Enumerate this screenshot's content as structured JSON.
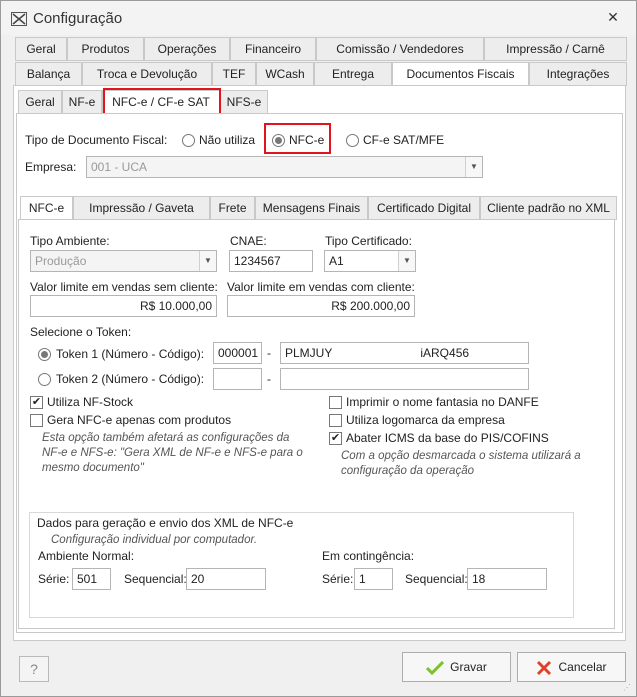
{
  "window": {
    "title": "Configuração"
  },
  "tabs_row1": [
    "Geral",
    "Produtos",
    "Operações",
    "Financeiro",
    "Comissão / Vendedores",
    "Impressão / Carnê"
  ],
  "tabs_row2": [
    "Balança",
    "Troca e Devolução",
    "TEF",
    "WCash",
    "Entrega",
    "Documentos Fiscais",
    "Integrações"
  ],
  "subtabs": [
    "Geral",
    "NF-e",
    "NFC-e / CF-e SAT",
    "NFS-e"
  ],
  "doc_type": {
    "label": "Tipo de Documento Fiscal:",
    "options": [
      "Não utiliza",
      "NFC-e",
      "CF-e SAT/MFE"
    ],
    "selected": "NFC-e"
  },
  "empresa": {
    "label": "Empresa:",
    "value": "001 - UCA"
  },
  "inner_tabs": [
    "NFC-e",
    "Impressão / Gaveta",
    "Frete",
    "Mensagens Finais",
    "Certificado Digital",
    "Cliente padrão no XML"
  ],
  "nfce": {
    "tipo_ambiente_label": "Tipo Ambiente:",
    "tipo_ambiente_value": "Produção",
    "cnae_label": "CNAE:",
    "cnae_value": "1234567",
    "tipo_cert_label": "Tipo Certificado:",
    "tipo_cert_value": "A1",
    "valor_sem_label": "Valor limite em vendas sem cliente:",
    "valor_sem_value": "R$ 10.000,00",
    "valor_com_label": "Valor limite em vendas com cliente:",
    "valor_com_value": "R$ 200.000,00",
    "token_label": "Selecione o Token:",
    "token1_label": "Token 1 (Número - Código):",
    "token1_num": "000001",
    "token1_code": "PLMJUY",
    "token1_code_end": "iARQ456",
    "token2_label": "Token 2 (Número - Código):",
    "token2_num": "",
    "token2_code": "",
    "dash": "-",
    "utiliza_nfstock": "Utiliza NF-Stock",
    "gera_nfce": "Gera NFC-e apenas com produtos",
    "gera_note": "Esta opção também afetará as configurações da NF-e e NFS-e: \"Gera XML de NF-e e NFS-e para o mesmo documento\"",
    "imprimir_fantasia": "Imprimir o nome fantasia no DANFE",
    "logomarca": "Utiliza logomarca da empresa",
    "abater_icms": "Abater ICMS da base do PIS/COFINS",
    "abater_note": "Com a opção desmarcada o sistema utilizará a configuração da operação"
  },
  "xml_group": {
    "title": "Dados para geração e envio dos XML de NFC-e",
    "subtitle": "Configuração individual por computador.",
    "normal_label": "Ambiente Normal:",
    "normal_serie_label": "Série:",
    "normal_serie": "501",
    "normal_seq_label": "Sequencial:",
    "normal_seq": "20",
    "cont_label": "Em contingência:",
    "cont_serie_label": "Série:",
    "cont_serie": "1",
    "cont_seq_label": "Sequencial:",
    "cont_seq": "18"
  },
  "buttons": {
    "help": "?",
    "save": "Gravar",
    "cancel": "Cancelar"
  },
  "colors": {
    "highlight": "#e0141b",
    "save_icon": "#7cc22a",
    "cancel_icon": "#e0412a"
  }
}
